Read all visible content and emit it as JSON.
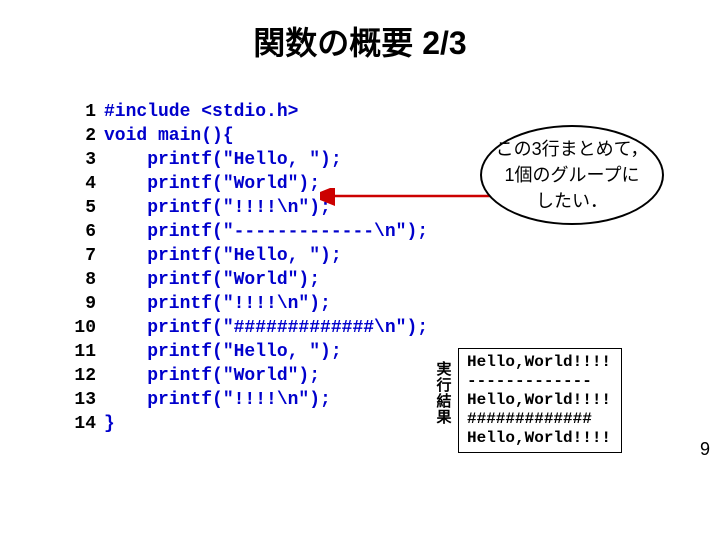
{
  "title": "関数の概要 2/3",
  "code": {
    "lines": [
      {
        "n": "1",
        "t": "#include <stdio.h>"
      },
      {
        "n": "2",
        "t": "void main(){"
      },
      {
        "n": "3",
        "t": "    printf(\"Hello, \");"
      },
      {
        "n": "4",
        "t": "    printf(\"World\");"
      },
      {
        "n": "5",
        "t": "    printf(\"!!!!\\n\");"
      },
      {
        "n": "6",
        "t": "    printf(\"-------------\\n\");"
      },
      {
        "n": "7",
        "t": "    printf(\"Hello, \");"
      },
      {
        "n": "8",
        "t": "    printf(\"World\");"
      },
      {
        "n": "9",
        "t": "    printf(\"!!!!\\n\");"
      },
      {
        "n": "10",
        "t": "    printf(\"#############\\n\");"
      },
      {
        "n": "11",
        "t": "    printf(\"Hello, \");"
      },
      {
        "n": "12",
        "t": "    printf(\"World\");"
      },
      {
        "n": "13",
        "t": "    printf(\"!!!!\\n\");"
      },
      {
        "n": "14",
        "t": "}"
      }
    ]
  },
  "balloon_text": "この3行まとめて，\n1個のグループに\nしたい．",
  "result_label": "実行結果",
  "result_output": "Hello,World!!!!\n-------------\nHello,World!!!!\n#############\nHello,World!!!!",
  "page_number": "9"
}
